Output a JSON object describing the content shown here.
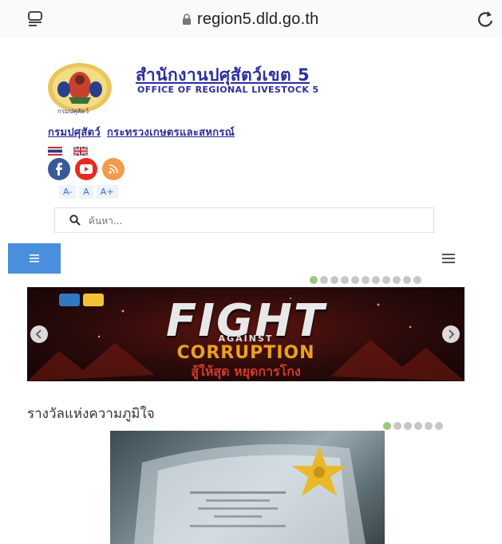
{
  "browser": {
    "url": "region5.dld.go.th"
  },
  "header": {
    "org_name_thai": "สำนักงานปศุสัตว์เขต 5",
    "org_name_english": "OFFICE OF REGIONAL LIVESTOCK 5",
    "logo_caption": "กรมปศุสัตว์",
    "links": [
      {
        "label": "กรมปศุสัตว์"
      },
      {
        "label": "กระทรวงเกษตรและสหกรณ์"
      }
    ]
  },
  "language_flags": [
    "thai-flag-icon",
    "uk-flag-icon"
  ],
  "social": {
    "items": [
      "facebook-icon",
      "youtube-icon",
      "rss-icon"
    ],
    "colors": {
      "facebook": "#3b5998",
      "youtube": "#e62b1e",
      "rss": "#f49b4a"
    }
  },
  "font_size_buttons": [
    "A-",
    "A",
    "A+"
  ],
  "search": {
    "placeholder": "ค้นหา..."
  },
  "nav": {
    "accent": "#4a8fdd"
  },
  "banner": {
    "slides_total": 11,
    "active_slide": 1,
    "title": "FIGHT",
    "subtitle": "AGAINST",
    "headline": "CORRUPTION",
    "thai_slogan": "สู้ให้สุด หยุดการโกง"
  },
  "awards_section": {
    "title": "รางวัลแห่งความภูมิใจ",
    "slides_total": 6,
    "active_slide": 1
  }
}
